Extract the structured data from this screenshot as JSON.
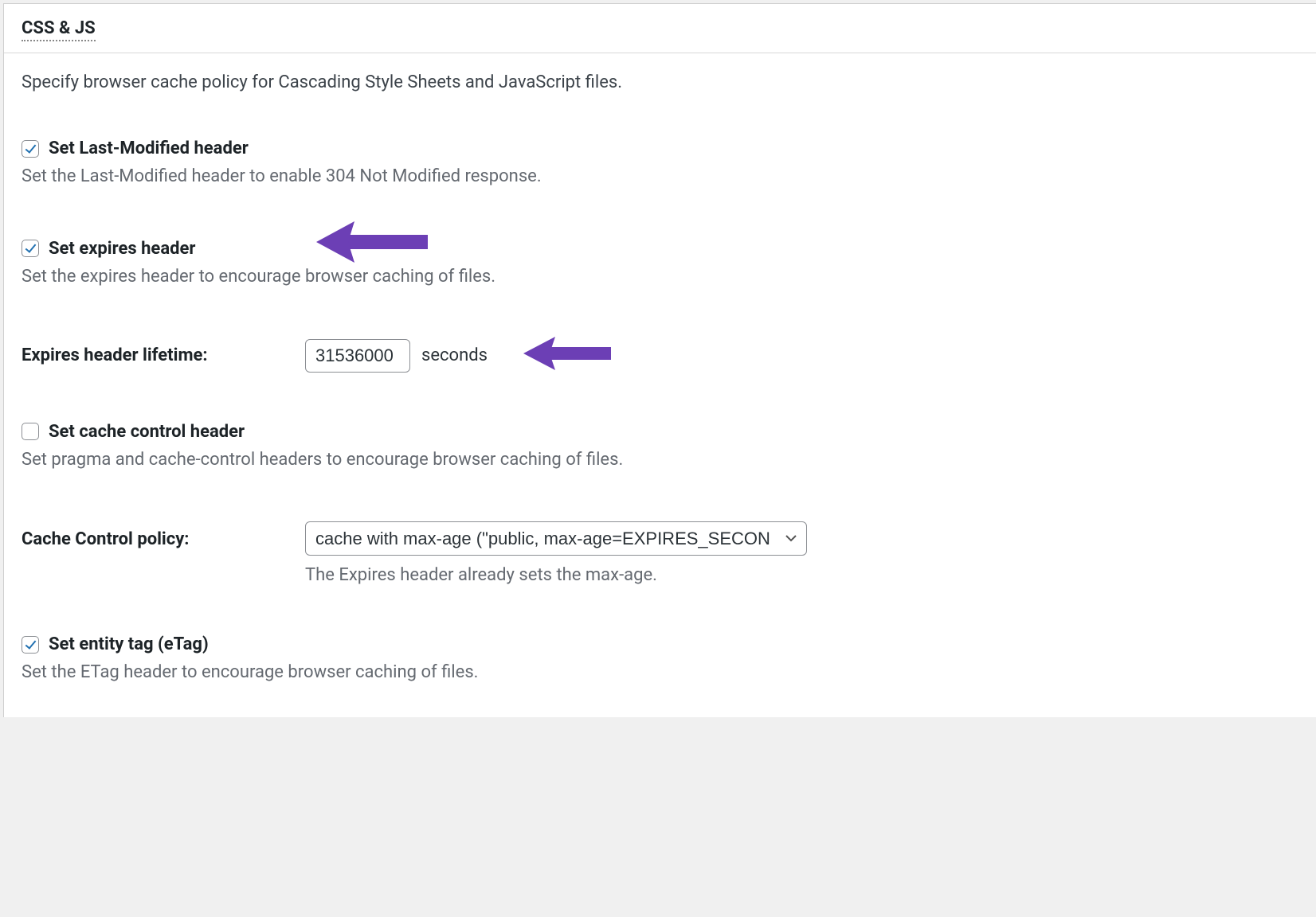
{
  "panel": {
    "title": "CSS & JS",
    "description": "Specify browser cache policy for Cascading Style Sheets and JavaScript files."
  },
  "options": {
    "last_modified": {
      "label": "Set Last-Modified header",
      "description": "Set the Last-Modified header to enable 304 Not Modified response.",
      "checked": true
    },
    "expires": {
      "label": "Set expires header",
      "description": "Set the expires header to encourage browser caching of files.",
      "checked": true
    },
    "expires_lifetime": {
      "label": "Expires header lifetime:",
      "value": "31536000",
      "unit": "seconds"
    },
    "cache_control": {
      "label": "Set cache control header",
      "description": "Set pragma and cache-control headers to encourage browser caching of files.",
      "checked": false
    },
    "cache_policy": {
      "label": "Cache Control policy:",
      "selected": "cache with max-age (\"public, max-age=EXPIRES_SECON",
      "note": "The Expires header already sets the max-age."
    },
    "etag": {
      "label": "Set entity tag (eTag)",
      "description": "Set the ETag header to encourage browser caching of files.",
      "checked": true
    }
  },
  "annotations": {
    "arrow_color": "#6c3fb5"
  }
}
